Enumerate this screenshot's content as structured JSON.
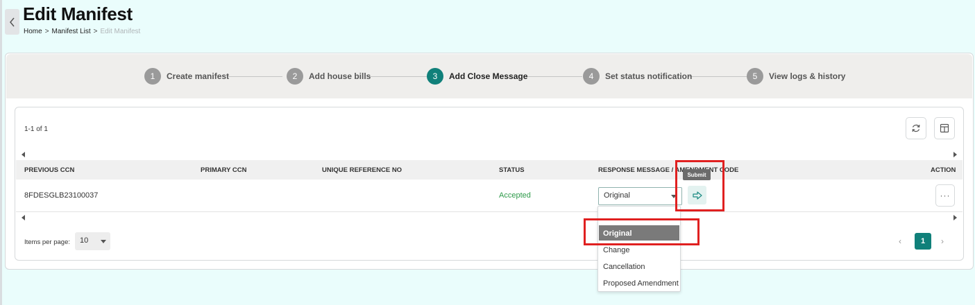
{
  "header": {
    "title": "Edit Manifest",
    "breadcrumb": [
      "Home",
      "Manifest List",
      "Edit Manifest"
    ],
    "separator": ">"
  },
  "stepper": {
    "steps": [
      {
        "number": "1",
        "label": "Create manifest",
        "active": false
      },
      {
        "number": "2",
        "label": "Add house bills",
        "active": false
      },
      {
        "number": "3",
        "label": "Add Close Message",
        "active": true
      },
      {
        "number": "4",
        "label": "Set status notification",
        "active": false
      },
      {
        "number": "5",
        "label": "View logs & history",
        "active": false
      }
    ],
    "colors": {
      "active": "#10807a",
      "inactive": "#9a9a9a"
    }
  },
  "table": {
    "count_text": "1-1 of 1",
    "columns": [
      "PREVIOUS CCN",
      "PRIMARY CCN",
      "UNIQUE REFERENCE NO",
      "STATUS",
      "RESPONSE MESSAGE / AMENDMENT CODE",
      "ACTION"
    ],
    "rows": [
      {
        "previous_ccn": "8FDESGLB23100037",
        "primary_ccn": "",
        "unique_reference_no": "",
        "status": "Accepted",
        "response_message": "Original"
      }
    ],
    "submit_tooltip": "Submit",
    "more_label": "···",
    "status_color": "#2e9a4a"
  },
  "dropdown": {
    "options": [
      "Original",
      "Change",
      "Cancellation",
      "Proposed Amendment"
    ],
    "selected": "Original"
  },
  "pagination": {
    "items_per_page_label": "Items per page:",
    "items_per_page_value": "10",
    "prev": "‹",
    "next": "›",
    "current_page": "1"
  },
  "icons": [
    "chevron-left-icon",
    "refresh-icon",
    "column-layout-icon",
    "arrow-right-icon",
    "more-icon"
  ],
  "annotations": {
    "highlight_color": "#e02020"
  }
}
